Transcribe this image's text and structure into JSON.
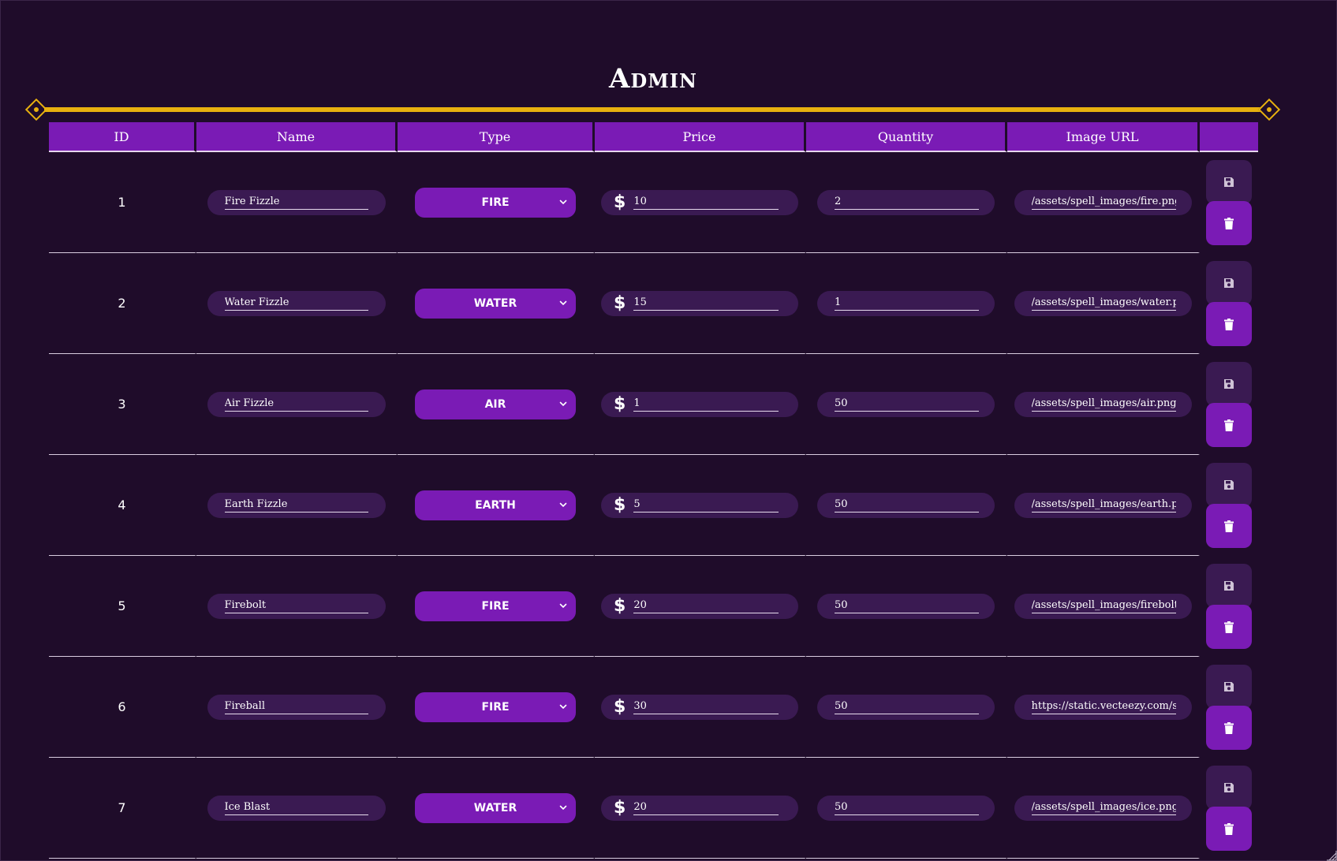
{
  "page": {
    "title": "Admin"
  },
  "table": {
    "headers": [
      "ID",
      "Name",
      "Type",
      "Price",
      "Quantity",
      "Image URL",
      ""
    ],
    "rows": [
      {
        "id": "1",
        "name": "Fire Fizzle",
        "type": "FIRE",
        "price": "10",
        "quantity": "2",
        "image_url": "/assets/spell_images/fire.png"
      },
      {
        "id": "2",
        "name": "Water Fizzle",
        "type": "WATER",
        "price": "15",
        "quantity": "1",
        "image_url": "/assets/spell_images/water.png"
      },
      {
        "id": "3",
        "name": "Air Fizzle",
        "type": "AIR",
        "price": "1",
        "quantity": "50",
        "image_url": "/assets/spell_images/air.png"
      },
      {
        "id": "4",
        "name": "Earth Fizzle",
        "type": "EARTH",
        "price": "5",
        "quantity": "50",
        "image_url": "/assets/spell_images/earth.png"
      },
      {
        "id": "5",
        "name": "Firebolt",
        "type": "FIRE",
        "price": "20",
        "quantity": "50",
        "image_url": "/assets/spell_images/firebolt.png"
      },
      {
        "id": "6",
        "name": "Fireball",
        "type": "FIRE",
        "price": "30",
        "quantity": "50",
        "image_url": "https://static.vecteezy.com/system"
      },
      {
        "id": "7",
        "name": "Ice Blast",
        "type": "WATER",
        "price": "20",
        "quantity": "50",
        "image_url": "/assets/spell_images/ice.png"
      }
    ],
    "currency_symbol": "$",
    "icons": {
      "save": "floppy-disk-icon",
      "delete": "trash-icon",
      "type_dropdown": "chevron-down-icon"
    }
  },
  "colors": {
    "background": "#1f0c2a",
    "accent_purple": "#7a1bb5",
    "field_bg": "#3a1a52",
    "gold": "#e8b10f"
  }
}
